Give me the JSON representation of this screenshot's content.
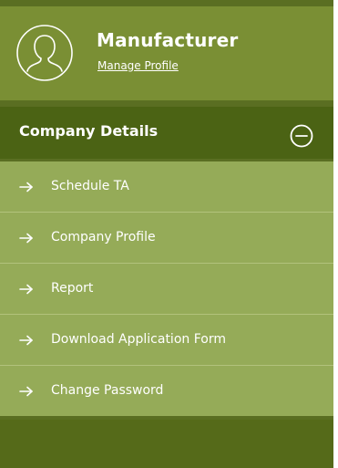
{
  "profile": {
    "name": "Manufacturer",
    "manage_label": "Manage Profile",
    "avatar_icon": "user-outline-icon"
  },
  "section": {
    "title": "Company Details",
    "state": "expanded",
    "toggle_icon": "minus-circle-icon"
  },
  "menu": {
    "item_icon": "arrow-right-icon",
    "items": [
      {
        "label": "Schedule TA"
      },
      {
        "label": "Company Profile"
      },
      {
        "label": "Report"
      },
      {
        "label": "Download Application Form"
      },
      {
        "label": "Change Password"
      }
    ]
  },
  "colors": {
    "profile_bg": "#7a8f34",
    "header_bg": "#4b6314",
    "menu_bg": "#95ab58",
    "divider": "#b2c27c",
    "text": "#ffffff"
  }
}
